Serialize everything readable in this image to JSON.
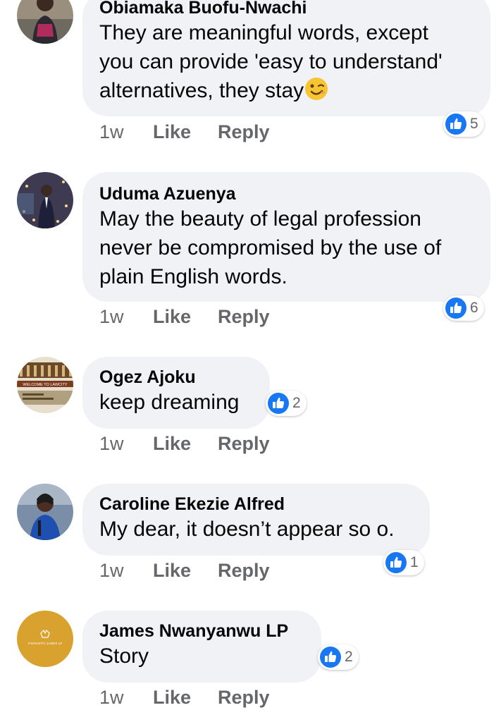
{
  "comments": [
    {
      "author": "Obiamaka Buofu-Nwachi",
      "text": "They are meaningful words, except\nyou can provide 'easy to understand'\nalternatives, they stay",
      "emoji": "winking-face",
      "time": "1w",
      "like_label": "Like",
      "reply_label": "Reply",
      "reaction_count": "5"
    },
    {
      "author": "Uduma Azuenya",
      "text": "May the beauty of legal profession\nnever be compromised by the use of\nplain English words.",
      "time": "1w",
      "like_label": "Like",
      "reply_label": "Reply",
      "reaction_count": "6"
    },
    {
      "author": "Ogez Ajoku",
      "text": "keep dreaming",
      "avatar_text": "WELCOME TO LAWCITY",
      "time": "1w",
      "like_label": "Like",
      "reply_label": "Reply",
      "reaction_count": "2"
    },
    {
      "author": "Caroline Ekezie Alfred",
      "text": "My dear, it doesn’t appear so o.",
      "time": "1w",
      "like_label": "Like",
      "reply_label": "Reply",
      "reaction_count": "1"
    },
    {
      "author": "James Nwanyanwu LP",
      "text": "Story",
      "avatar_text": "FANTASTIC JAMES LP",
      "time": "1w",
      "like_label": "Like",
      "reply_label": "Reply",
      "reaction_count": "2"
    }
  ],
  "colors": {
    "bubble": "#f0f2f5",
    "like_blue": "#1877f2",
    "meta_gray": "#65676b",
    "avatar_gold": "#d9a22e"
  }
}
